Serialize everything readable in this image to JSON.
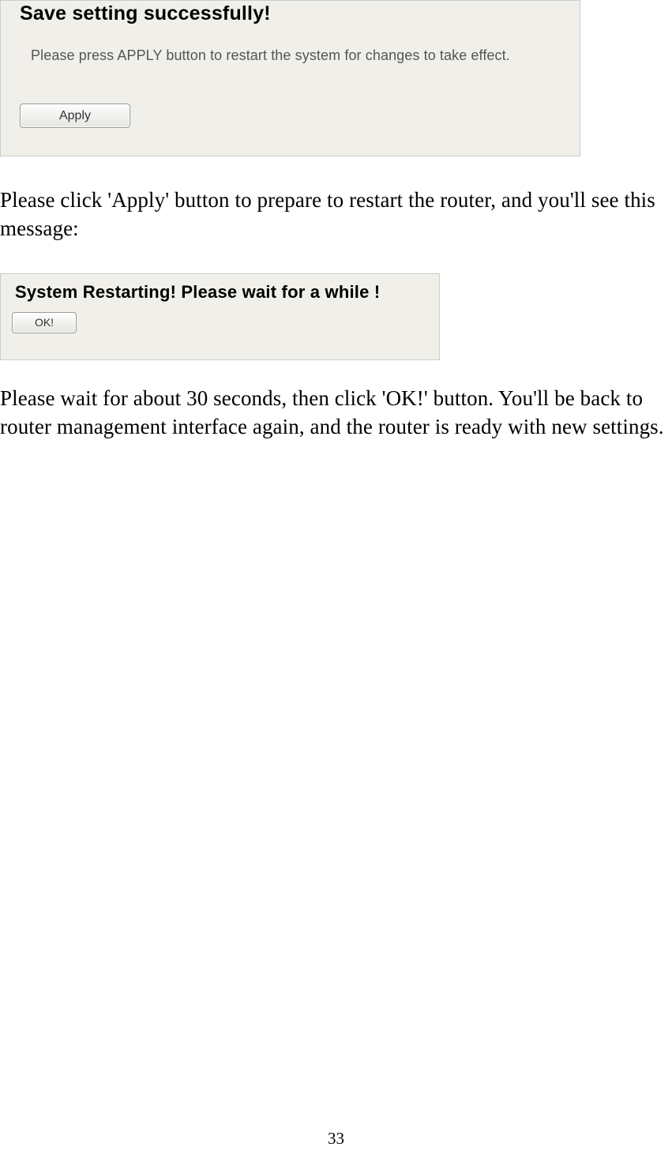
{
  "panel1": {
    "title": "Save setting successfully!",
    "description": "Please press APPLY button to restart the system for changes to take effect.",
    "button": "Apply"
  },
  "paragraph1": "Please click 'Apply' button to prepare to restart the router, and you'll see this message:",
  "panel2": {
    "title": "System Restarting! Please wait for a while !",
    "button": "OK!"
  },
  "paragraph2": "Please wait for about 30 seconds, then click 'OK!' button. You'll be back to router management interface again, and the router is ready with new settings.",
  "pageNumber": "33"
}
